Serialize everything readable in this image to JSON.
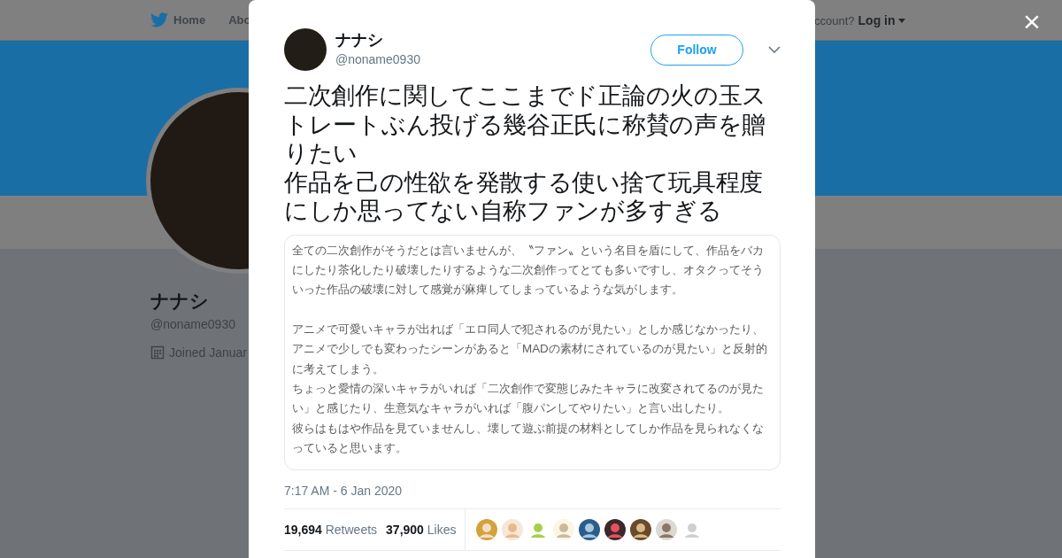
{
  "background_page": {
    "nav": {
      "home": "Home",
      "about": "Abo",
      "account_prompt": "ccount?",
      "login": "Log in"
    },
    "profile": {
      "name": "ナナシ",
      "handle": "@noname0930",
      "joined": "Joined Januar"
    }
  },
  "tweet": {
    "author": {
      "name": "ナナシ",
      "handle": "@noname0930"
    },
    "follow_button": "Follow",
    "text": [
      "二次創作に関してここまでド正論の火の玉ストレートぶん投げる幾谷正氏に称賛の声を贈りたい",
      "作品を己の性欲を発散する使い捨て玩具程度にしか思ってない自称ファンが多すぎる"
    ],
    "attached_text": [
      "全ての二次創作がそうだとは言いませんが、〝ファン〟という名目を盾にして、作品をバカにしたり茶化したり破壊したりするような二次創作ってとても多いですし、オタクってそういった作品の破壊に対して感覚が麻痺してしまっているような気がします。",
      "アニメで可愛いキャラが出れば「エロ同人で犯されるのが見たい」としか感じなかったり、",
      "アニメで少しでも変わったシーンがあると「MADの素材にされているのが見たい」と反射的に考えてしまう。",
      "ちょっと愛情の深いキャラがいれば「二次創作で変態じみたキャラに改変されてるのが見たい」と感じたり、生意気なキャラがいれば「腹パンしてやりたい」と言い出したり。",
      "彼らはもはや作品を見ていませんし、壊して遊ぶ前提の材料としてしか作品を見られなくなっていると思います。"
    ],
    "timestamp": "7:17 AM - 6 Jan 2020",
    "stats": [
      {
        "count": "19,694",
        "label": "Retweets"
      },
      {
        "count": "37,900",
        "label": "Likes"
      }
    ]
  },
  "close_button": "×"
}
